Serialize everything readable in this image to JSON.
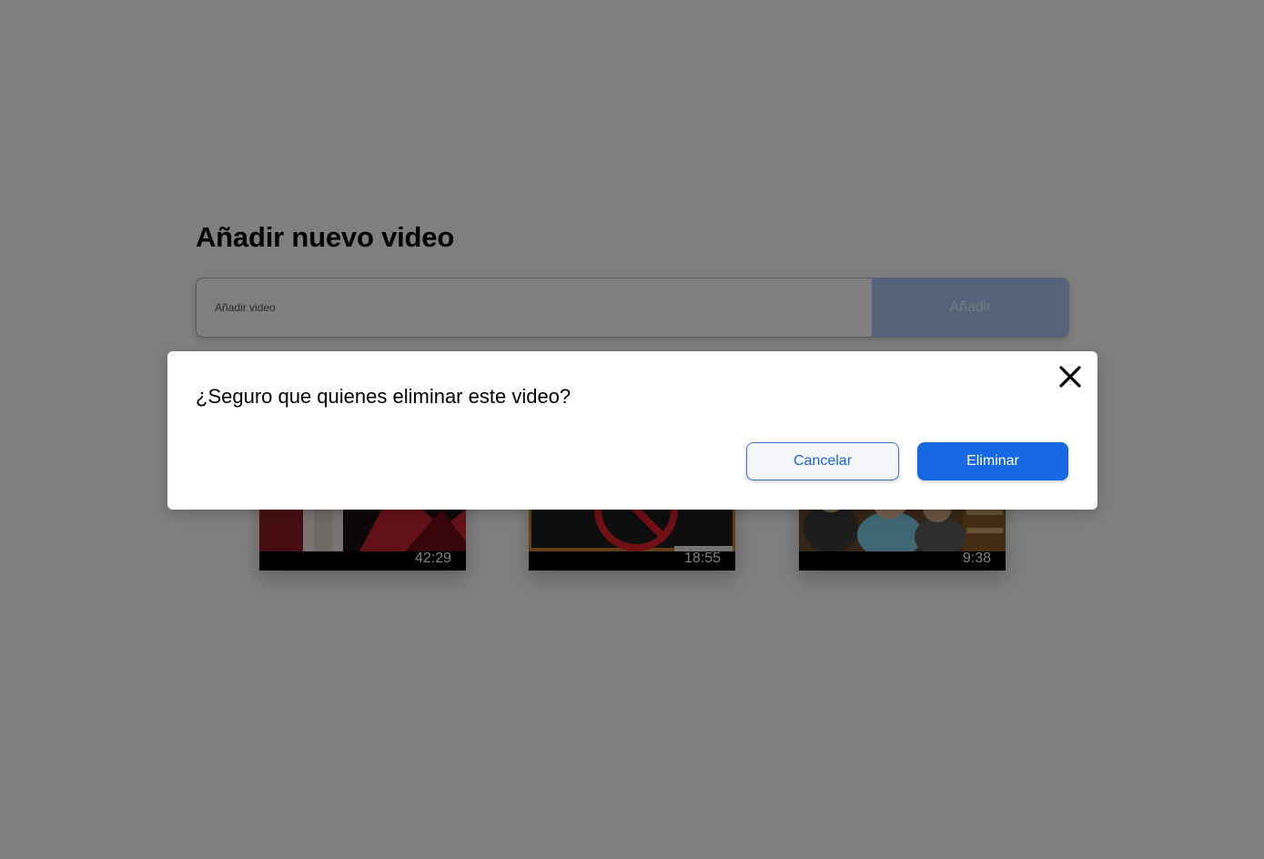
{
  "page": {
    "title": "Añadir nuevo video",
    "input_placeholder": "Añadir video",
    "add_button_label": "Añadir"
  },
  "videos": [
    {
      "duration": "42:29"
    },
    {
      "duration": "18:55"
    },
    {
      "duration": "9:38"
    }
  ],
  "modal": {
    "message": "¿Seguro que quienes eliminar este video?",
    "cancel_label": "Cancelar",
    "delete_label": "Eliminar"
  },
  "colors": {
    "primary": "#1668e3",
    "overlay": "rgba(0,0,0,0.5)"
  },
  "icons": {
    "close": "close-icon"
  }
}
